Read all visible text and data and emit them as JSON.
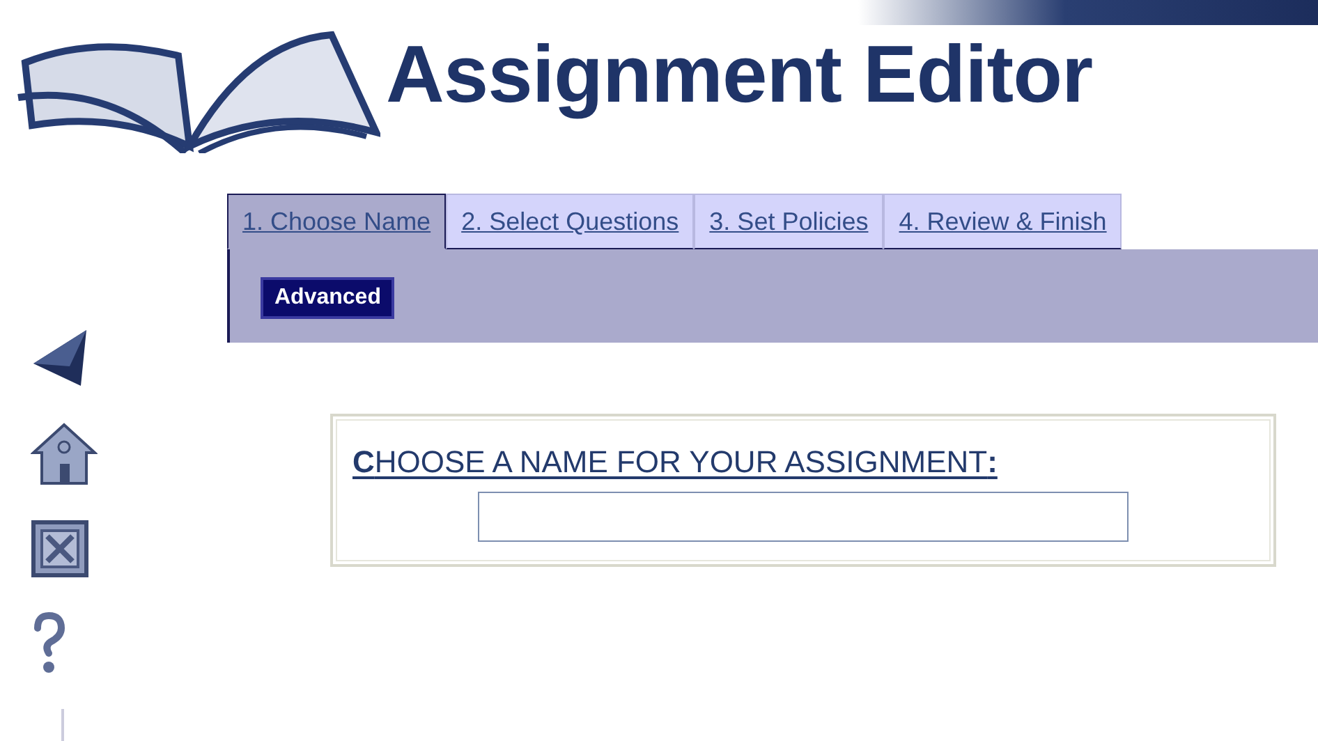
{
  "header": {
    "title": "Assignment Editor"
  },
  "tabs": [
    {
      "label": "1. Choose Name",
      "selected": true
    },
    {
      "label": "2. Select Questions",
      "selected": false
    },
    {
      "label": "3. Set Policies",
      "selected": false
    },
    {
      "label": "4. Review & Finish",
      "selected": false
    }
  ],
  "subtabs": [
    {
      "label": "Advanced",
      "selected": true
    }
  ],
  "form": {
    "heading": "**C**HOOSE A NAME FOR YOUR ASSIGNMENT**:**"
  }
}
